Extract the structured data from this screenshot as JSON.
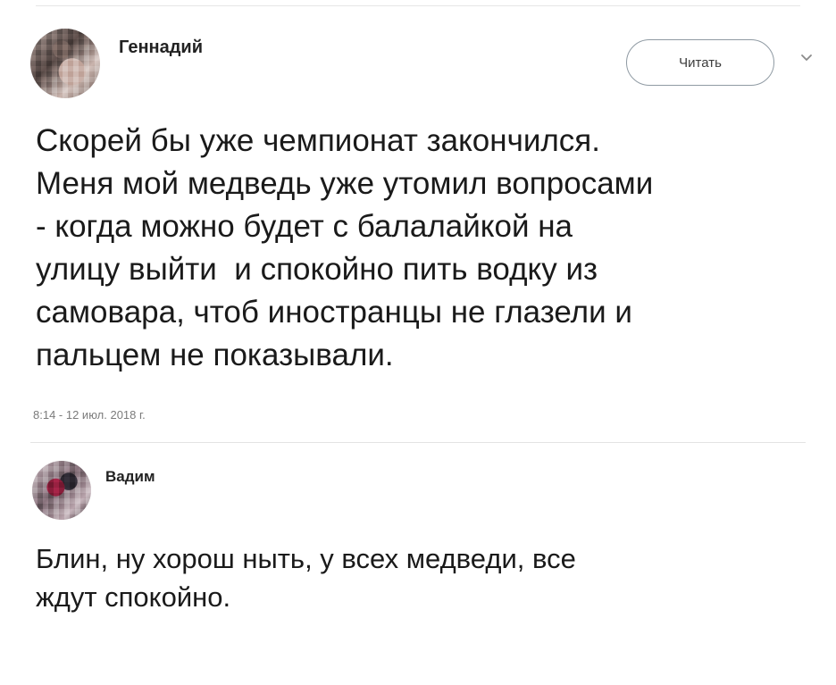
{
  "tweet": {
    "author": "Геннадий",
    "follow_label": "Читать",
    "text_lines": [
      "Скорей бы уже чемпионат закончился.",
      "Меня мой медведь уже утомил вопросами",
      "- когда можно будет с балалайкой на",
      "улицу выйти  и спокойно пить водку из",
      "самовара, чтоб иностранцы не глазели и",
      "пальцем не показывали."
    ],
    "timestamp": "8:14 - 12 июл. 2018 г."
  },
  "reply": {
    "author": "Вадим",
    "text_lines": [
      "Блин, ну хорош ныть, у всех медведи, все",
      "ждут спокойно."
    ]
  },
  "icons": {
    "menu": "chevron-down-icon"
  }
}
